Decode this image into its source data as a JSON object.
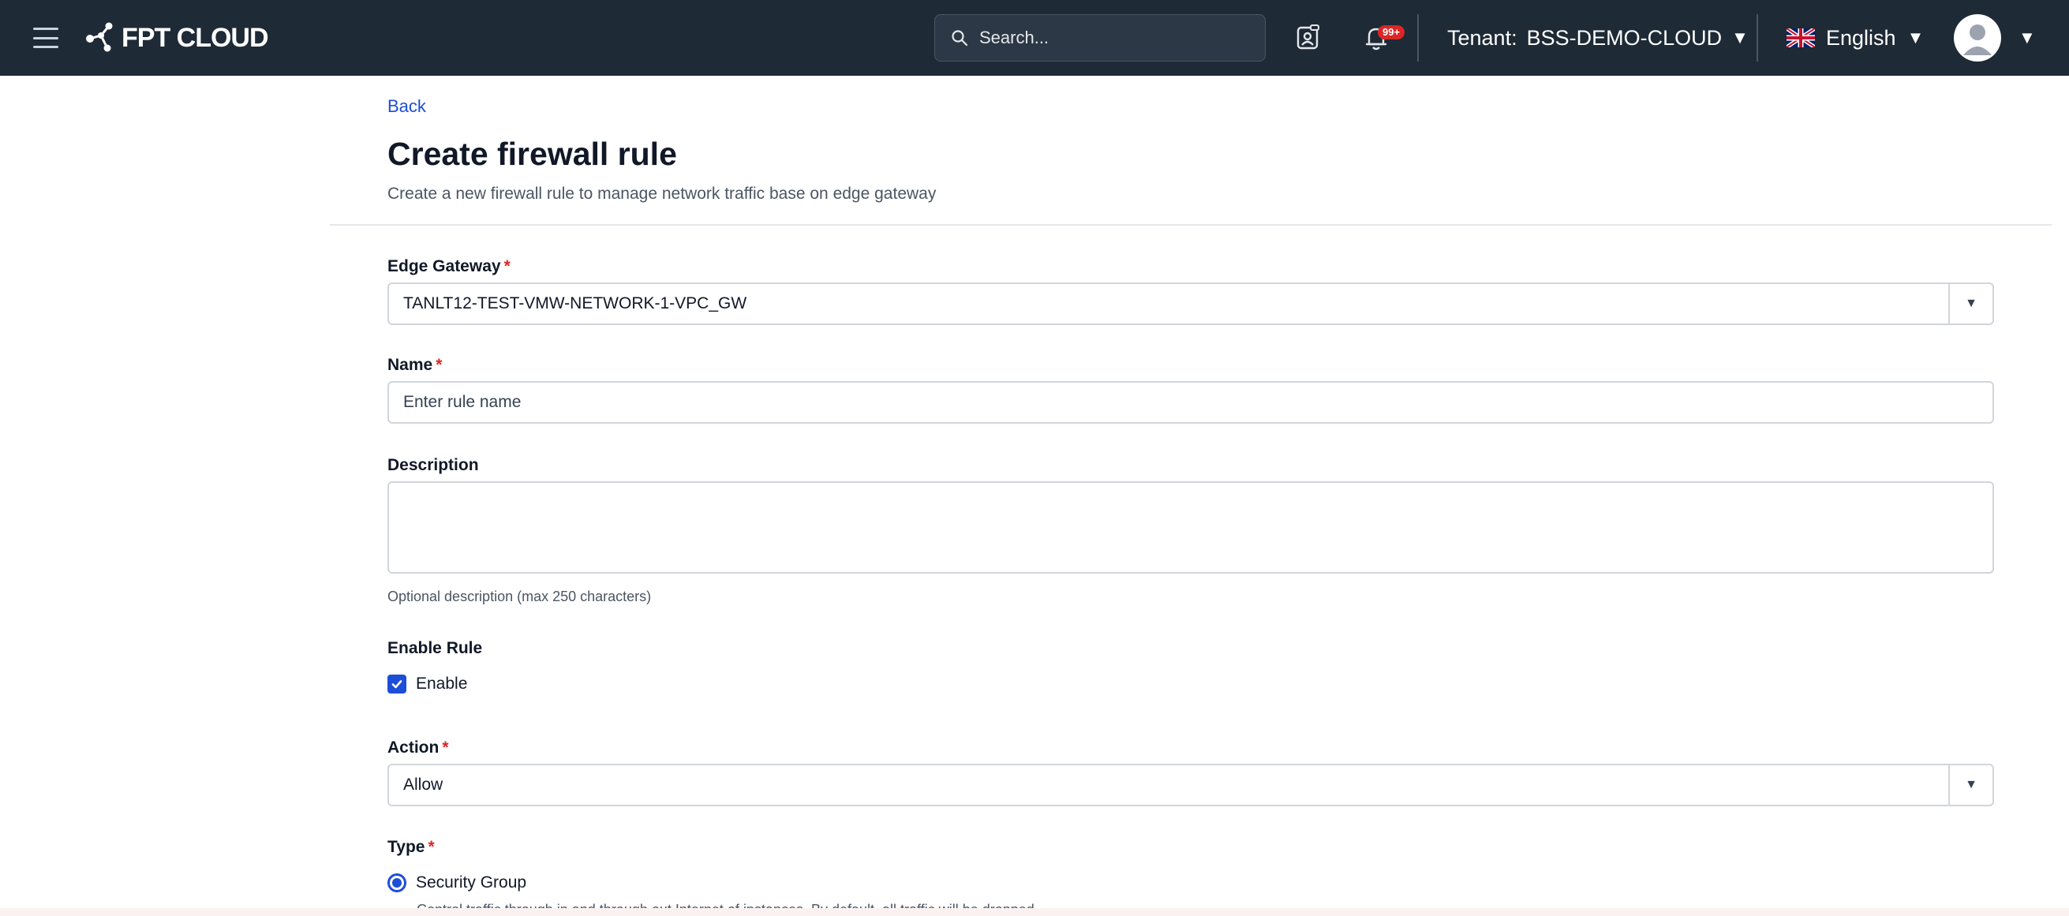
{
  "topbar": {
    "logo_text": "FPT CLOUD",
    "search_placeholder": "Search...",
    "notifications_badge": "99+",
    "tenant_label": "Tenant:",
    "tenant_value": "BSS-DEMO-CLOUD",
    "language": "English"
  },
  "header": {
    "back_label": "Back",
    "title": "Create firewall rule",
    "subtitle": "Create a new firewall rule to manage network traffic base on edge gateway"
  },
  "form": {
    "required_mark": "*",
    "edge_gateway": {
      "label": "Edge Gateway",
      "value": "TANLT12-TEST-VMW-NETWORK-1-VPC_GW"
    },
    "name": {
      "label": "Name",
      "placeholder": "Enter rule name"
    },
    "description": {
      "label": "Description",
      "help": "Optional description (max 250 characters)"
    },
    "enable_rule": {
      "label": "Enable Rule",
      "option": "Enable",
      "checked": true
    },
    "action": {
      "label": "Action",
      "value": "Allow"
    },
    "type": {
      "label": "Type",
      "selected_option": "Security Group",
      "selected_description": "Control traffic through in and through out Internet of instances. By default, all traffic will be dropped."
    }
  },
  "colors": {
    "topbar_bg": "#1e2a36",
    "accent": "#1d4ed8",
    "required": "#dc2626"
  }
}
